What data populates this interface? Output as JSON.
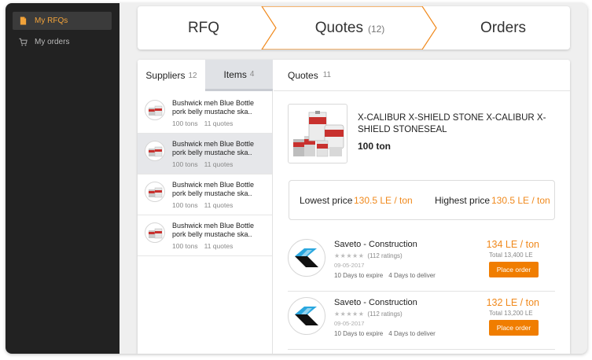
{
  "sidebar": {
    "items": [
      {
        "label": "My RFQs",
        "icon": "document-icon",
        "active": true
      },
      {
        "label": "My orders",
        "icon": "cart-icon",
        "active": false
      }
    ]
  },
  "stepper": {
    "steps": [
      {
        "label": "RFQ",
        "count": ""
      },
      {
        "label": "Quotes",
        "count": "(12)"
      },
      {
        "label": "Orders",
        "count": ""
      }
    ],
    "active_color": "#f0891c"
  },
  "left_tabs": {
    "suppliers": {
      "label": "Suppliers",
      "count": "12"
    },
    "items": {
      "label": "Items",
      "count": "4"
    }
  },
  "items": [
    {
      "title": "Bushwick meh Blue Bottle pork belly mustache ska..",
      "tons": "100 tons",
      "quotes": "11 quotes",
      "selected": false
    },
    {
      "title": "Bushwick meh Blue Bottle pork belly mustache ska..",
      "tons": "100 tons",
      "quotes": "11 quotes",
      "selected": true
    },
    {
      "title": "Bushwick meh Blue Bottle pork belly mustache ska..",
      "tons": "100 tons",
      "quotes": "11 quotes",
      "selected": false
    },
    {
      "title": "Bushwick meh Blue Bottle pork belly mustache ska..",
      "tons": "100 tons",
      "quotes": "11 quotes",
      "selected": false
    }
  ],
  "quotes_tab": {
    "label": "Quotes",
    "count": "11"
  },
  "product": {
    "name": "X-CALIBUR X-SHIELD STONE X-CALIBUR X-SHIELD STONESEAL",
    "qty": "100 ton"
  },
  "price_range": {
    "lowest_label": "Lowest price",
    "lowest_value": "130.5 LE / ton",
    "highest_label": "Highest price",
    "highest_value": "130.5 LE / ton"
  },
  "quotes": [
    {
      "supplier": "Saveto - Construction",
      "stars": "★★★★★",
      "ratings": "(112 ratings)",
      "date": "09-05-2017",
      "expire": "10 Days to expire",
      "deliver": "4 Days to deliver",
      "price": "134 LE / ton",
      "total": "Total 13,400 LE",
      "button": "Place order"
    },
    {
      "supplier": "Saveto - Construction",
      "stars": "★★★★★",
      "ratings": "(112 ratings)",
      "date": "09-05-2017",
      "expire": "10 Days to expire",
      "deliver": "4 Days to deliver",
      "price": "132 LE / ton",
      "total": "Total 13,200 LE",
      "button": "Place order"
    }
  ],
  "colors": {
    "accent": "#f0891c",
    "button": "#f07d00",
    "sidebar_bg": "#222222"
  }
}
